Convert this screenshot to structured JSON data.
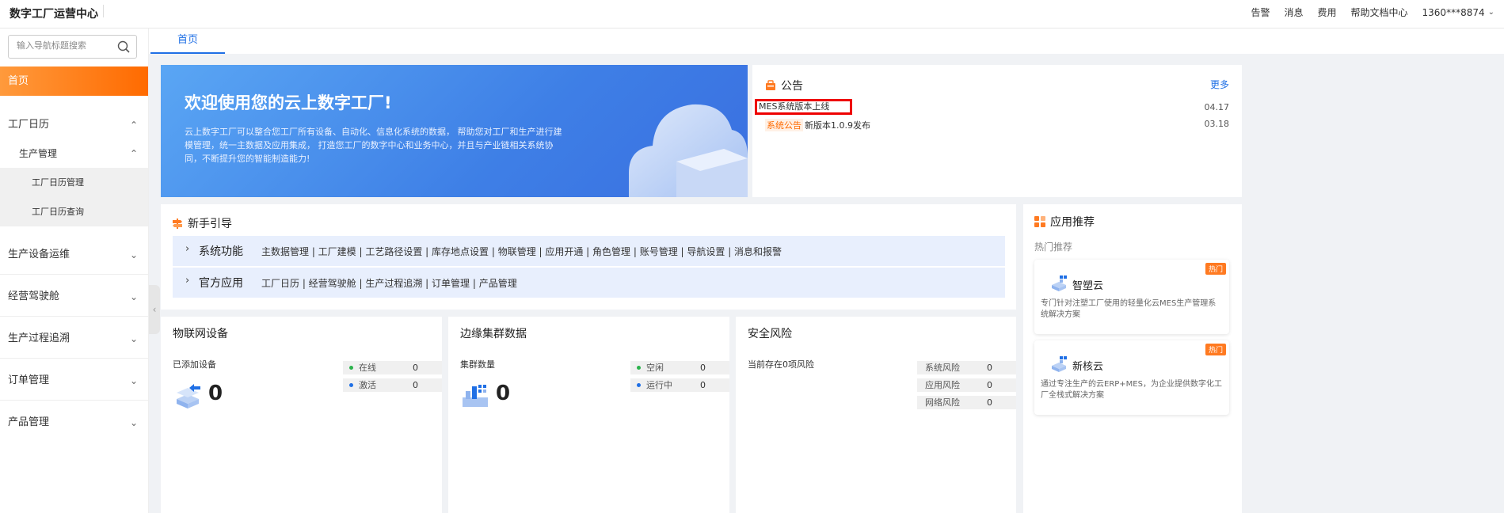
{
  "header": {
    "title": "数字工厂运营中心",
    "nav": [
      "告警",
      "消息",
      "费用",
      "帮助文档中心"
    ],
    "user": "1360***8874"
  },
  "sidebar": {
    "search_placeholder": "输入导航标题搜索",
    "home": "首页",
    "items": [
      {
        "label": "工厂日历",
        "arrow": "up"
      },
      {
        "label": "生产管理",
        "arrow": "up"
      },
      {
        "label": "工厂日历管理"
      },
      {
        "label": "工厂日历查询"
      },
      {
        "label": "生产设备运维",
        "arrow": "down"
      },
      {
        "label": "经营驾驶舱",
        "arrow": "down"
      },
      {
        "label": "生产过程追溯",
        "arrow": "down"
      },
      {
        "label": "订单管理",
        "arrow": "down"
      },
      {
        "label": "产品管理",
        "arrow": "down"
      }
    ]
  },
  "tabs": [
    {
      "label": "首页"
    }
  ],
  "banner": {
    "title": "欢迎使用您的云上数字工厂!",
    "desc": "云上数字工厂可以整合您工厂所有设备、自动化、信息化系统的数据，  帮助您对工厂和生产进行建模管理，统一主数据及应用集成，  打造您工厂的数字中心和业务中心，并且与产业链相关系统协同，不断提升您的智能制造能力!"
  },
  "notice": {
    "title": "公告",
    "more": "更多",
    "items": [
      {
        "text": "MES系统版本上线",
        "date": "04.17"
      },
      {
        "tag": "系统公告",
        "text": "新版本1.0.9发布",
        "date": "03.18"
      }
    ]
  },
  "guide": {
    "title": "新手引导",
    "rows": [
      {
        "title": "系统功能",
        "links": "主数据管理 | 工厂建模 | 工艺路径设置 | 库存地点设置 | 物联管理 | 应用开通 | 角色管理 | 账号管理 | 导航设置 | 消息和报警"
      },
      {
        "title": "官方应用",
        "links": "工厂日历 | 经营驾驶舱 | 生产过程追溯 | 订单管理 | 产品管理"
      }
    ]
  },
  "cards": {
    "iot": {
      "title": "物联网设备",
      "sub": "已添加设备",
      "count": "0",
      "stats": [
        {
          "label": "在线",
          "value": "0"
        },
        {
          "label": "激活",
          "value": "0"
        }
      ]
    },
    "edge": {
      "title": "边缘集群数据",
      "sub": "集群数量",
      "count": "0",
      "stats": [
        {
          "label": "空闲",
          "value": "0"
        },
        {
          "label": "运行中",
          "value": "0"
        }
      ]
    },
    "risk": {
      "title": "安全风险",
      "sub": "当前存在0项风险",
      "stats": [
        {
          "label": "系统风险",
          "value": "0"
        },
        {
          "label": "应用风险",
          "value": "0"
        },
        {
          "label": "网络风险",
          "value": "0"
        }
      ]
    }
  },
  "apps": {
    "title": "应用推荐",
    "sub": "热门推荐",
    "items": [
      {
        "name": "智塑云",
        "hot": "热门",
        "desc": "专门针对注塑工厂使用的轻量化云MES生产管理系统解决方案"
      },
      {
        "name": "新核云",
        "hot": "热门",
        "desc": "通过专注生产的云ERP+MES，为企业提供数字化工厂全栈式解决方案"
      }
    ]
  },
  "colors": {
    "accent": "#1f6fe5",
    "brand_orange": "#ff6a00",
    "online_dot": "#2bb24c",
    "active_dot": "#1f6fe5"
  }
}
